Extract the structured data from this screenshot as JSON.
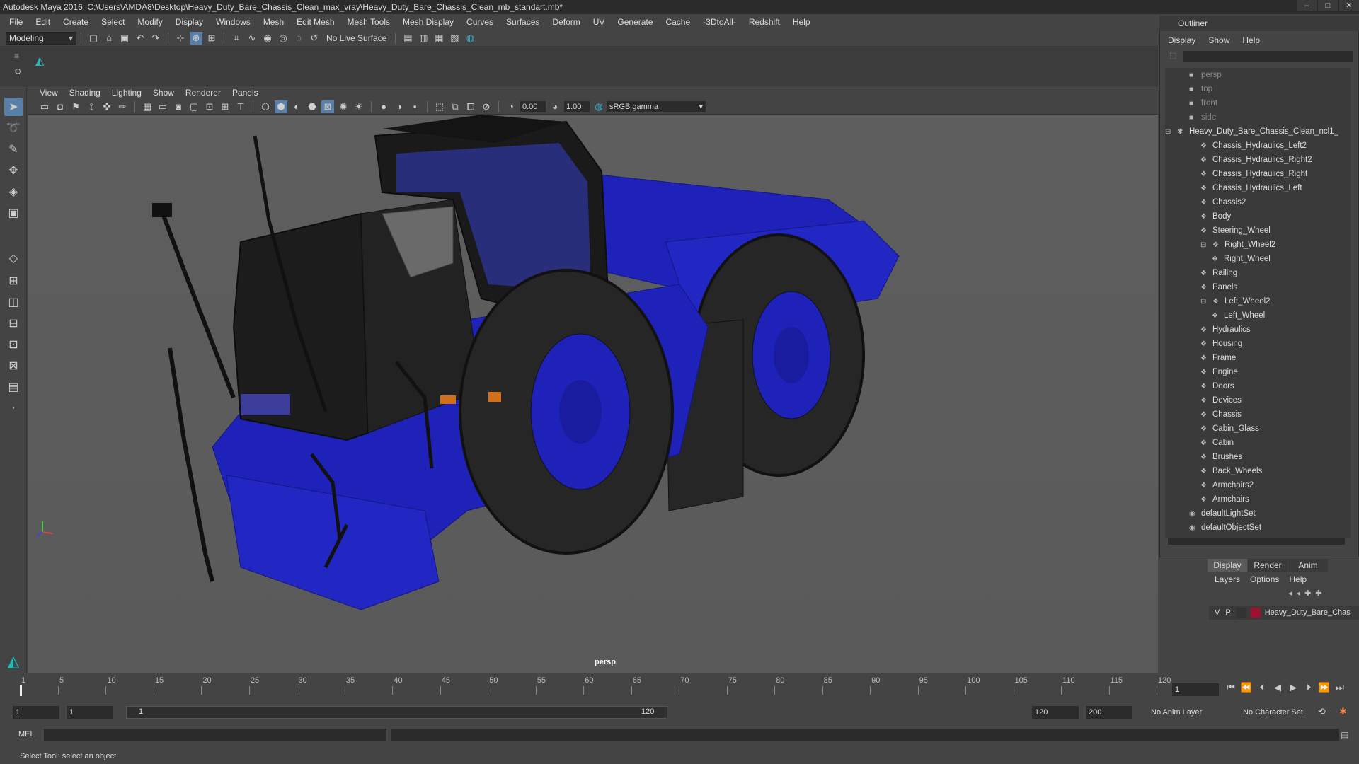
{
  "window": {
    "title": "Autodesk Maya 2016: C:\\Users\\AMDA8\\Desktop\\Heavy_Duty_Bare_Chassis_Clean_max_vray\\Heavy_Duty_Bare_Chassis_Clean_mb_standart.mb*",
    "min": "–",
    "max": "□",
    "close": "✕"
  },
  "menu": [
    "File",
    "Edit",
    "Create",
    "Select",
    "Modify",
    "Display",
    "Windows",
    "Mesh",
    "Edit Mesh",
    "Mesh Tools",
    "Mesh Display",
    "Curves",
    "Surfaces",
    "Deform",
    "UV",
    "Generate",
    "Cache",
    "-3DtoAll-",
    "Redshift",
    "Help"
  ],
  "status": {
    "mode": "Modeling",
    "live_surface": "No Live Surface"
  },
  "viewport": {
    "menu": [
      "View",
      "Shading",
      "Lighting",
      "Show",
      "Renderer",
      "Panels"
    ],
    "near": "0.00",
    "far": "1.00",
    "color_space": "sRGB gamma",
    "camera": "persp"
  },
  "outliner": {
    "title": "Outliner",
    "menu": [
      "Display",
      "Show",
      "Help"
    ],
    "items": [
      {
        "label": "persp",
        "depth": 0,
        "dim": true,
        "icon": "camera-icon"
      },
      {
        "label": "top",
        "depth": 0,
        "dim": true,
        "icon": "camera-icon"
      },
      {
        "label": "front",
        "depth": 0,
        "dim": true,
        "icon": "camera-icon"
      },
      {
        "label": "side",
        "depth": 0,
        "dim": true,
        "icon": "camera-icon"
      },
      {
        "label": "Heavy_Duty_Bare_Chassis_Clean_ncl1_",
        "depth": 0,
        "dim": false,
        "icon": "asterisk-icon",
        "expander": "−"
      },
      {
        "label": "Chassis_Hydraulics_Left2",
        "depth": 1,
        "icon": "mesh-icon"
      },
      {
        "label": "Chassis_Hydraulics_Right2",
        "depth": 1,
        "icon": "mesh-icon"
      },
      {
        "label": "Chassis_Hydraulics_Right",
        "depth": 1,
        "icon": "mesh-icon"
      },
      {
        "label": "Chassis_Hydraulics_Left",
        "depth": 1,
        "icon": "mesh-icon"
      },
      {
        "label": "Chassis2",
        "depth": 1,
        "icon": "mesh-icon"
      },
      {
        "label": "Body",
        "depth": 1,
        "icon": "mesh-icon"
      },
      {
        "label": "Steering_Wheel",
        "depth": 1,
        "icon": "mesh-icon"
      },
      {
        "label": "Right_Wheel2",
        "depth": 1,
        "icon": "mesh-icon",
        "expander": "−"
      },
      {
        "label": "Right_Wheel",
        "depth": 2,
        "icon": "mesh-icon"
      },
      {
        "label": "Railing",
        "depth": 1,
        "icon": "mesh-icon"
      },
      {
        "label": "Panels",
        "depth": 1,
        "icon": "mesh-icon"
      },
      {
        "label": "Left_Wheel2",
        "depth": 1,
        "icon": "mesh-icon",
        "expander": "−"
      },
      {
        "label": "Left_Wheel",
        "depth": 2,
        "icon": "mesh-icon"
      },
      {
        "label": "Hydraulics",
        "depth": 1,
        "icon": "mesh-icon"
      },
      {
        "label": "Housing",
        "depth": 1,
        "icon": "mesh-icon"
      },
      {
        "label": "Frame",
        "depth": 1,
        "icon": "mesh-icon"
      },
      {
        "label": "Engine",
        "depth": 1,
        "icon": "mesh-icon"
      },
      {
        "label": "Doors",
        "depth": 1,
        "icon": "mesh-icon"
      },
      {
        "label": "Devices",
        "depth": 1,
        "icon": "mesh-icon"
      },
      {
        "label": "Chassis",
        "depth": 1,
        "icon": "mesh-icon"
      },
      {
        "label": "Cabin_Glass",
        "depth": 1,
        "icon": "mesh-icon"
      },
      {
        "label": "Cabin",
        "depth": 1,
        "icon": "mesh-icon"
      },
      {
        "label": "Brushes",
        "depth": 1,
        "icon": "mesh-icon"
      },
      {
        "label": "Back_Wheels",
        "depth": 1,
        "icon": "mesh-icon"
      },
      {
        "label": "Armchairs2",
        "depth": 1,
        "icon": "mesh-icon"
      },
      {
        "label": "Armchairs",
        "depth": 1,
        "icon": "mesh-icon"
      },
      {
        "label": "defaultLightSet",
        "depth": 0,
        "icon": "set-icon"
      },
      {
        "label": "defaultObjectSet",
        "depth": 0,
        "icon": "set-icon"
      }
    ]
  },
  "layers": {
    "tabs": [
      "Display",
      "Render",
      "Anim"
    ],
    "menu": [
      "Layers",
      "Options",
      "Help"
    ],
    "row": {
      "v": "V",
      "p": "P",
      "name": "Heavy_Duty_Bare_Chas"
    },
    "color": "#a01030"
  },
  "timeline": {
    "ticks": [
      "1",
      "5",
      "10",
      "15",
      "20",
      "25",
      "30",
      "35",
      "40",
      "45",
      "50",
      "55",
      "60",
      "65",
      "70",
      "75",
      "80",
      "85",
      "90",
      "95",
      "100",
      "105",
      "110",
      "115",
      "120"
    ],
    "current": "1"
  },
  "range": {
    "start": "1",
    "inner_start": "1",
    "slider_start": "1",
    "slider_end": "120",
    "end": "120",
    "max": "200",
    "anim_layer": "No Anim Layer",
    "char_set": "No Character Set"
  },
  "command": {
    "mel": "MEL"
  },
  "help": "Select Tool: select an object",
  "colors": {
    "truck_blue": "#1f22b8",
    "truck_black": "#1a1a1a"
  }
}
